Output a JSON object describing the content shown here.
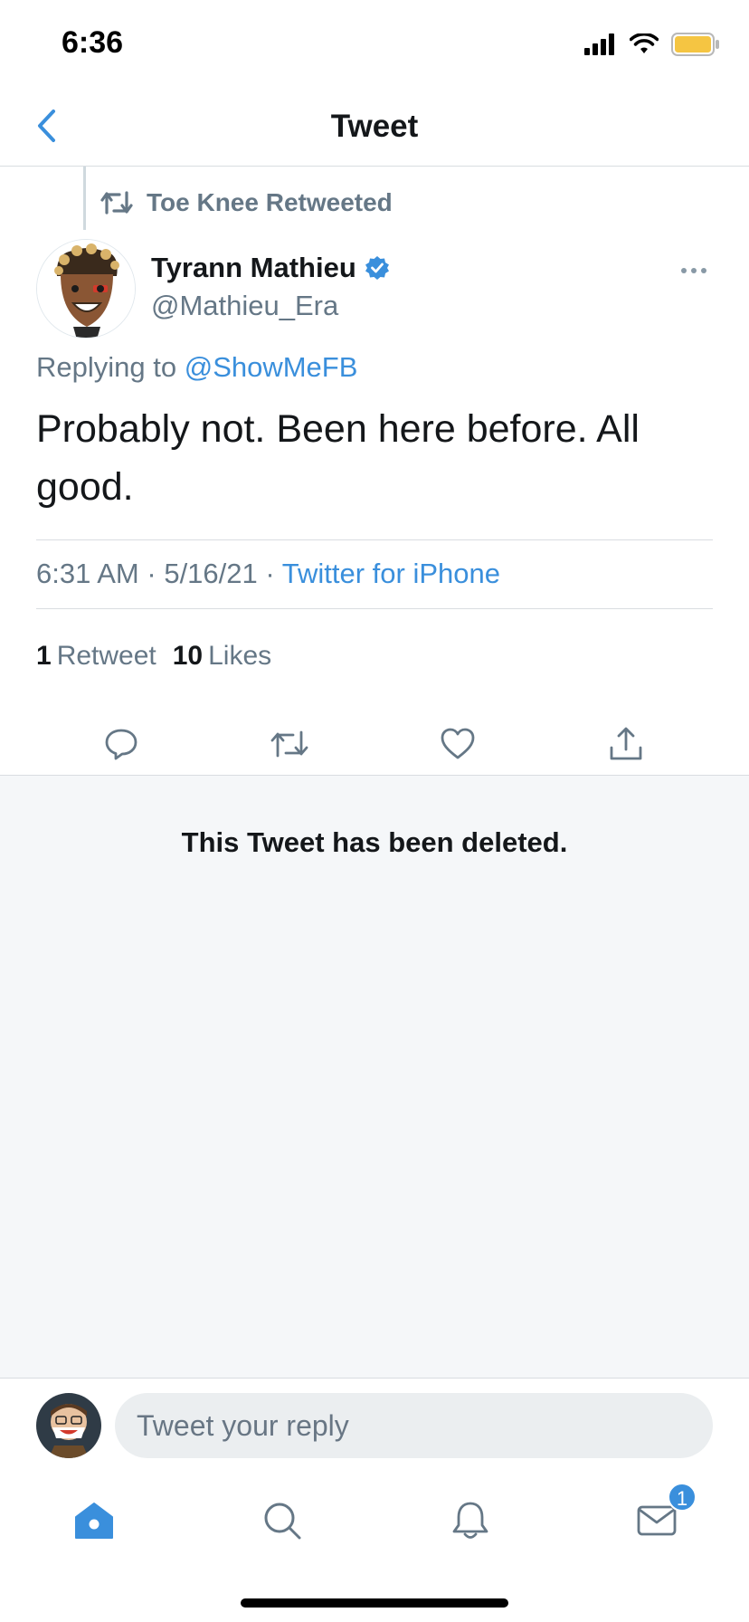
{
  "status_bar": {
    "time": "6:36"
  },
  "header": {
    "title": "Tweet"
  },
  "tweet": {
    "social_context": "Toe Knee Retweeted",
    "author_name": "Tyrann Mathieu",
    "author_handle": "@Mathieu_Era",
    "replying_prefix": "Replying to",
    "replying_to": "@ShowMeFB",
    "text": "Probably not. Been here before. All good.",
    "time": "6:31 AM",
    "date": "5/16/21",
    "separator": "·",
    "source": "Twitter for iPhone",
    "retweet_count": "1",
    "retweet_label": "Retweet",
    "like_count": "10",
    "like_label": "Likes"
  },
  "deleted": {
    "message": "This Tweet has been deleted."
  },
  "reply": {
    "placeholder": "Tweet your reply"
  },
  "tabs": {
    "messages_badge": "1"
  },
  "colors": {
    "accent": "#3a8fdc",
    "secondary_text": "#657786",
    "deleted_bg": "#f5f7f9",
    "battery": "#f5c542"
  },
  "icons": [
    "chevron-left-icon",
    "retweet-icon",
    "verified-icon",
    "more-icon",
    "reply-icon",
    "like-icon",
    "share-icon",
    "home-icon",
    "search-icon",
    "notifications-icon",
    "messages-icon"
  ]
}
